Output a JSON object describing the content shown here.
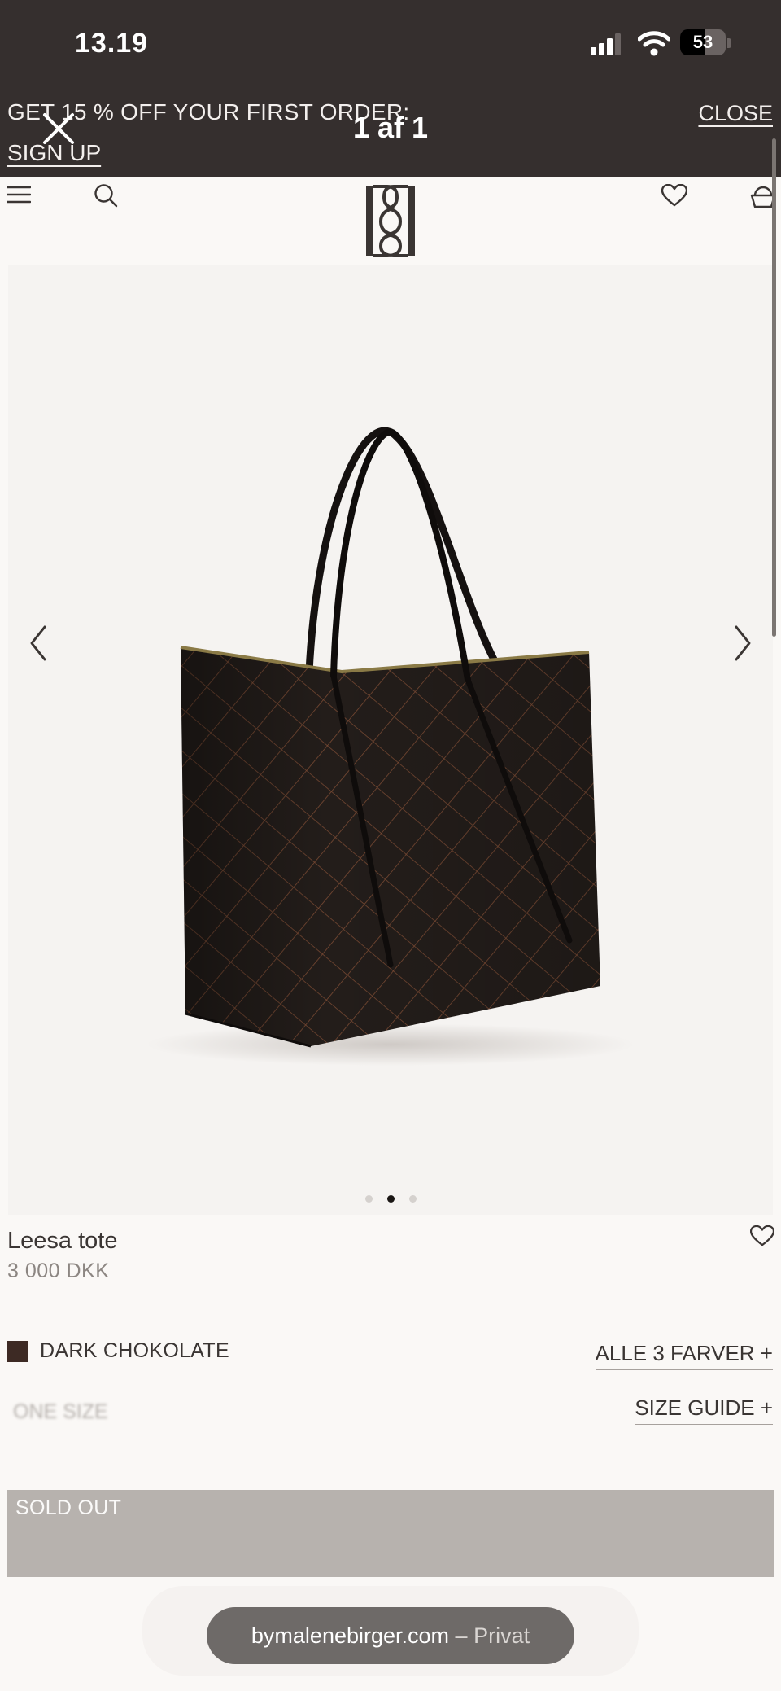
{
  "status_bar": {
    "time": "13.19",
    "battery": "53",
    "battery_level": 0.53
  },
  "promo": {
    "text": "GET 15 % OFF YOUR FIRST ORDER:",
    "signup": "SIGN UP",
    "close": "CLOSE"
  },
  "viewer": {
    "count": "1 af 1"
  },
  "product": {
    "name": "Leesa tote",
    "price": "3 000 DKK"
  },
  "color": {
    "name": "DARK CHOKOLATE",
    "swatch": "#3d2a24",
    "all_colors": "ALLE 3 FARVER +"
  },
  "size": {
    "value": "ONE SIZE",
    "guide": "SIZE GUIDE +"
  },
  "cta": {
    "label": "SOLD OUT"
  },
  "gallery": {
    "dots": 3,
    "active": 1
  },
  "browser": {
    "domain": "bymalenebirger.com",
    "mode": "– Privat"
  }
}
